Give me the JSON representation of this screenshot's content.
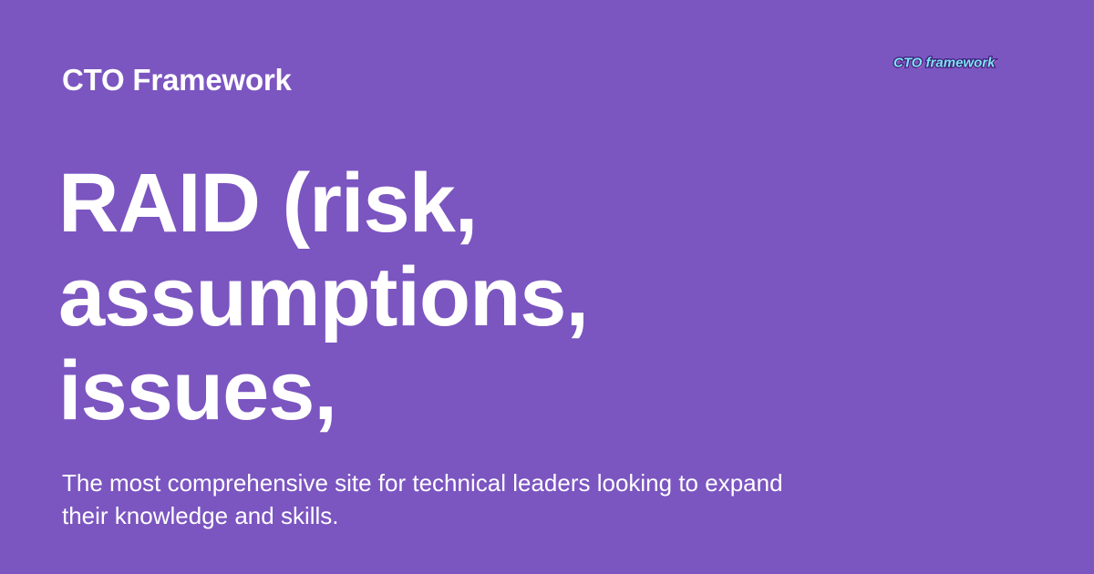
{
  "background_color": "#7b55c0",
  "text_color": "#ffffff",
  "site_name": "CTO Framework",
  "logo": {
    "text": "CTO framework",
    "icon": "cto-framework-logo",
    "colors": [
      "#7fe3f0",
      "#ff7ad9",
      "#3a1c7a"
    ]
  },
  "headline": {
    "lines": [
      "RAID (risk,",
      "assumptions,",
      "issues,"
    ]
  },
  "tagline": "The most comprehensive site for technical leaders looking to expand their knowledge and skills."
}
